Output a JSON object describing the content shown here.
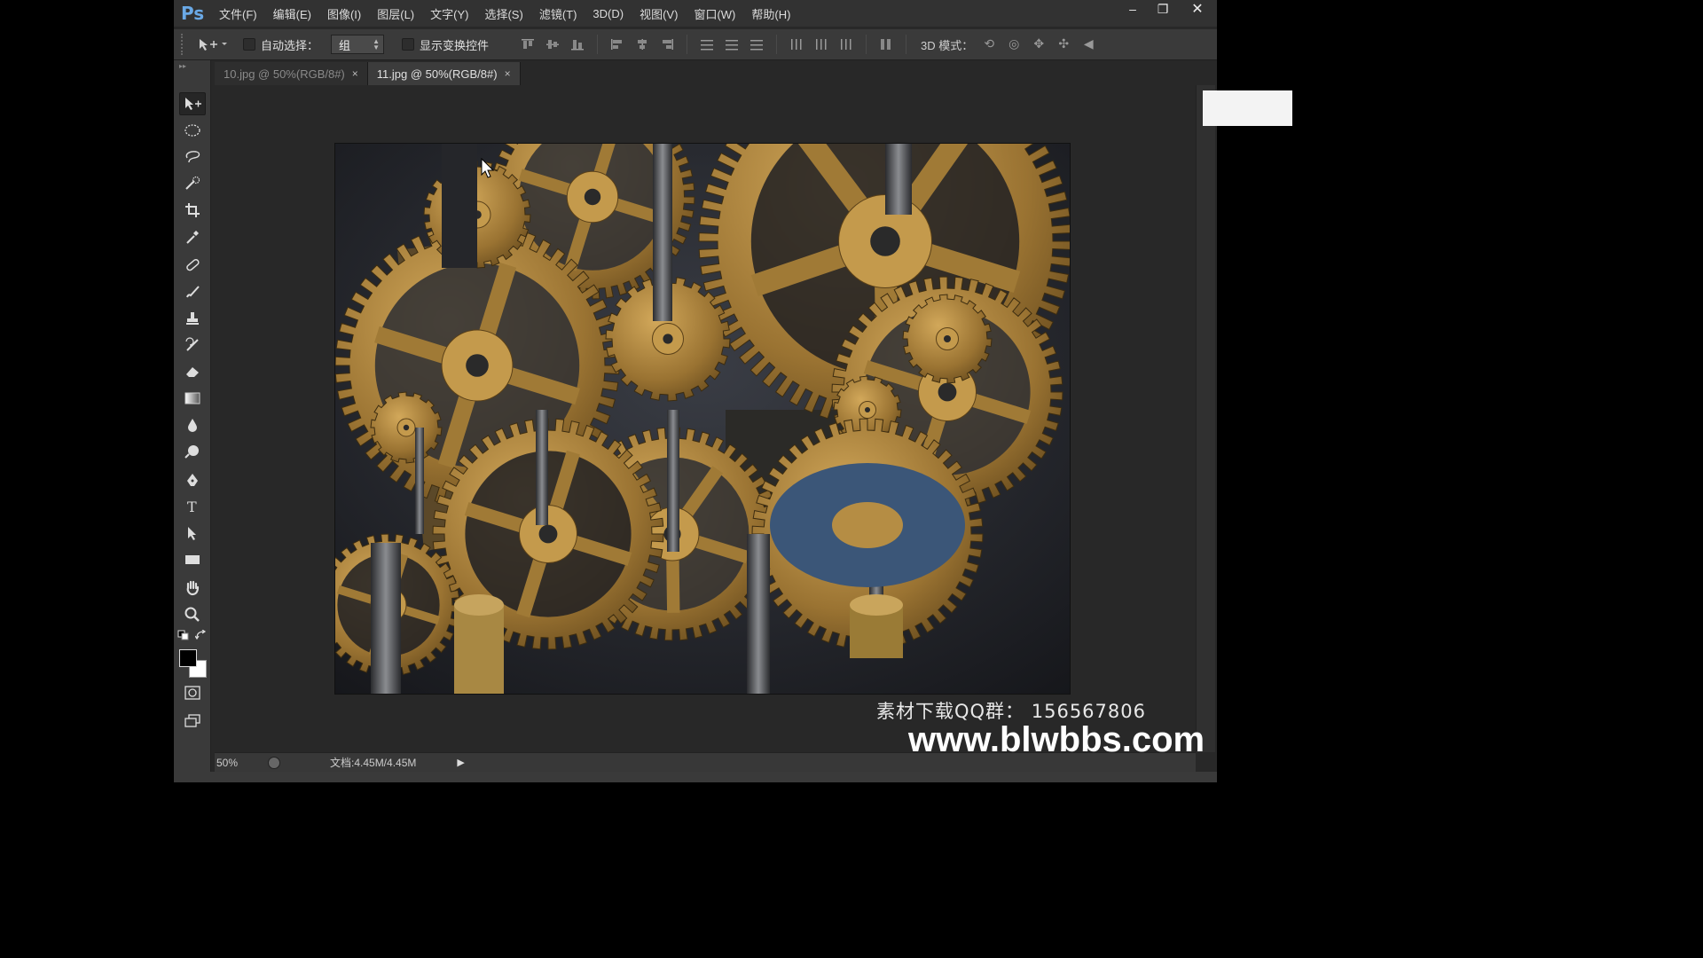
{
  "app": {
    "logo": "Ps",
    "window_controls": {
      "minimize": "–",
      "restore": "❐",
      "close": "✕"
    }
  },
  "menu": [
    "文件(F)",
    "编辑(E)",
    "图像(I)",
    "图层(L)",
    "文字(Y)",
    "选择(S)",
    "滤镜(T)",
    "3D(D)",
    "视图(V)",
    "窗口(W)",
    "帮助(H)"
  ],
  "options": {
    "auto_select_label": "自动选择：",
    "auto_select_checked": false,
    "auto_select_value": "组",
    "show_transform_label": "显示变换控件",
    "show_transform_checked": false,
    "mode_3d_label": "3D 模式："
  },
  "tabs": [
    {
      "label": "10.jpg @ 50%(RGB/8#)",
      "close": "×",
      "active": false
    },
    {
      "label": "11.jpg @ 50%(RGB/8#)",
      "close": "×",
      "active": true
    }
  ],
  "tools": [
    "move-tool-icon",
    "elliptical-marquee-tool-icon",
    "lasso-tool-icon",
    "quick-selection-tool-icon",
    "crop-tool-icon",
    "eyedropper-tool-icon",
    "healing-brush-tool-icon",
    "brush-tool-icon",
    "clone-stamp-tool-icon",
    "history-brush-tool-icon",
    "eraser-tool-icon",
    "gradient-tool-icon",
    "blur-tool-icon",
    "dodge-tool-icon",
    "pen-tool-icon",
    "type-tool-icon",
    "path-selection-tool-icon",
    "rectangle-tool-icon",
    "hand-tool-icon",
    "zoom-tool-icon"
  ],
  "status": {
    "zoom": "50%",
    "doc_info": "文档:4.45M/4.45M",
    "arrow": "▶"
  },
  "watermark": {
    "qq": "素材下载QQ群： 156567806",
    "url": "www.blwbbs.com"
  },
  "colors": {
    "foreground": "#000000",
    "background": "#ffffff",
    "brass": "#a5803c"
  }
}
